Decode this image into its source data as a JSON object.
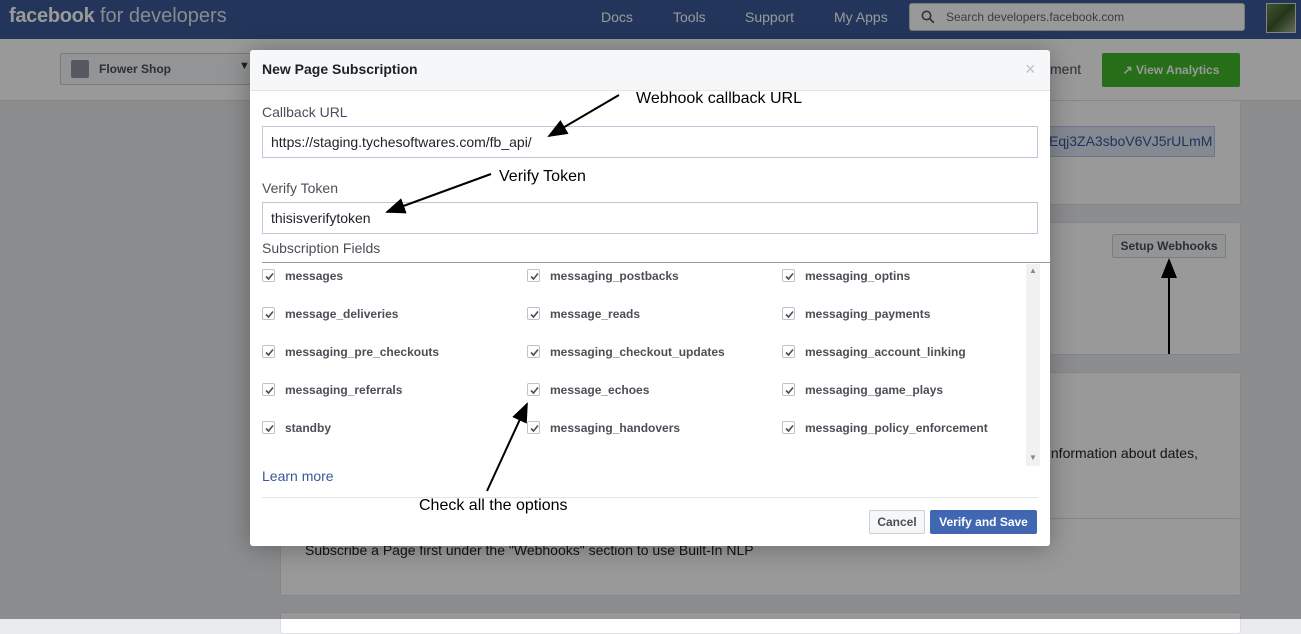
{
  "header": {
    "brand_bold": "facebook",
    "brand_rest": "for developers",
    "nav": [
      "Docs",
      "Tools",
      "Support",
      "My Apps"
    ],
    "search_placeholder": "Search developers.facebook.com"
  },
  "subbar": {
    "app_name": "Flower Shop",
    "tab_partial": "ment",
    "analytics_label": "View Analytics"
  },
  "background": {
    "token_text": "Eqj3ZA3sboV6VJ5rULmM",
    "setup_webhooks": "Setup Webhooks",
    "info_text": "t information about dates,",
    "nlp_text": "Subscribe a Page first under the \"Webhooks\" section to use Built-In NLP"
  },
  "modal": {
    "title": "New Page Subscription",
    "close": "×",
    "callback_label": "Callback URL",
    "callback_value": "https://staging.tychesoftwares.com/fb_api/",
    "verify_label": "Verify Token",
    "verify_value": "thisisverifytoken",
    "fields_label": "Subscription Fields",
    "fields": [
      [
        "messages",
        "messaging_postbacks",
        "messaging_optins"
      ],
      [
        "message_deliveries",
        "message_reads",
        "messaging_payments"
      ],
      [
        "messaging_pre_checkouts",
        "messaging_checkout_updates",
        "messaging_account_linking"
      ],
      [
        "messaging_referrals",
        "message_echoes",
        "messaging_game_plays"
      ],
      [
        "standby",
        "messaging_handovers",
        "messaging_policy_enforcement"
      ]
    ],
    "learn_more": "Learn more",
    "cancel": "Cancel",
    "save": "Verify and Save"
  },
  "annotations": {
    "callback": "Webhook callback URL",
    "verify": "Verify Token",
    "check": "Check all the options"
  },
  "colors": {
    "header": "#3b5998",
    "accent": "#4267b2",
    "green": "#42b72a"
  }
}
